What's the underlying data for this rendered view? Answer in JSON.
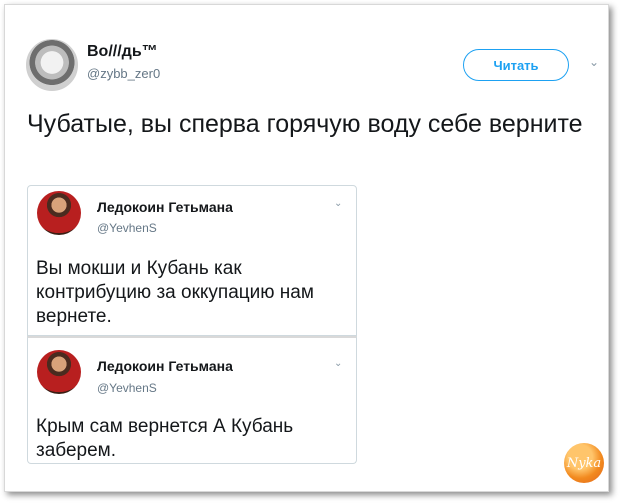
{
  "tweet": {
    "display_name": "Во///дь™",
    "handle": "@zybb_zer0",
    "follow_label": "Читать",
    "text": "Чубатые, вы сперва горячую воду себе верните"
  },
  "quotes": [
    {
      "name": "Ледокоин Гетьмана",
      "handle": "@YevhenS",
      "text": "Вы мокши и Кубань как контрибуцию за оккупацию нам вернете."
    },
    {
      "name": "Ледокоин Гетьмана",
      "handle": "@YevhenS",
      "text": "Крым сам вернется А Кубань заберем."
    }
  ],
  "icons": {
    "menu": "chevron-down-icon"
  },
  "watermark_text": "Nyka"
}
